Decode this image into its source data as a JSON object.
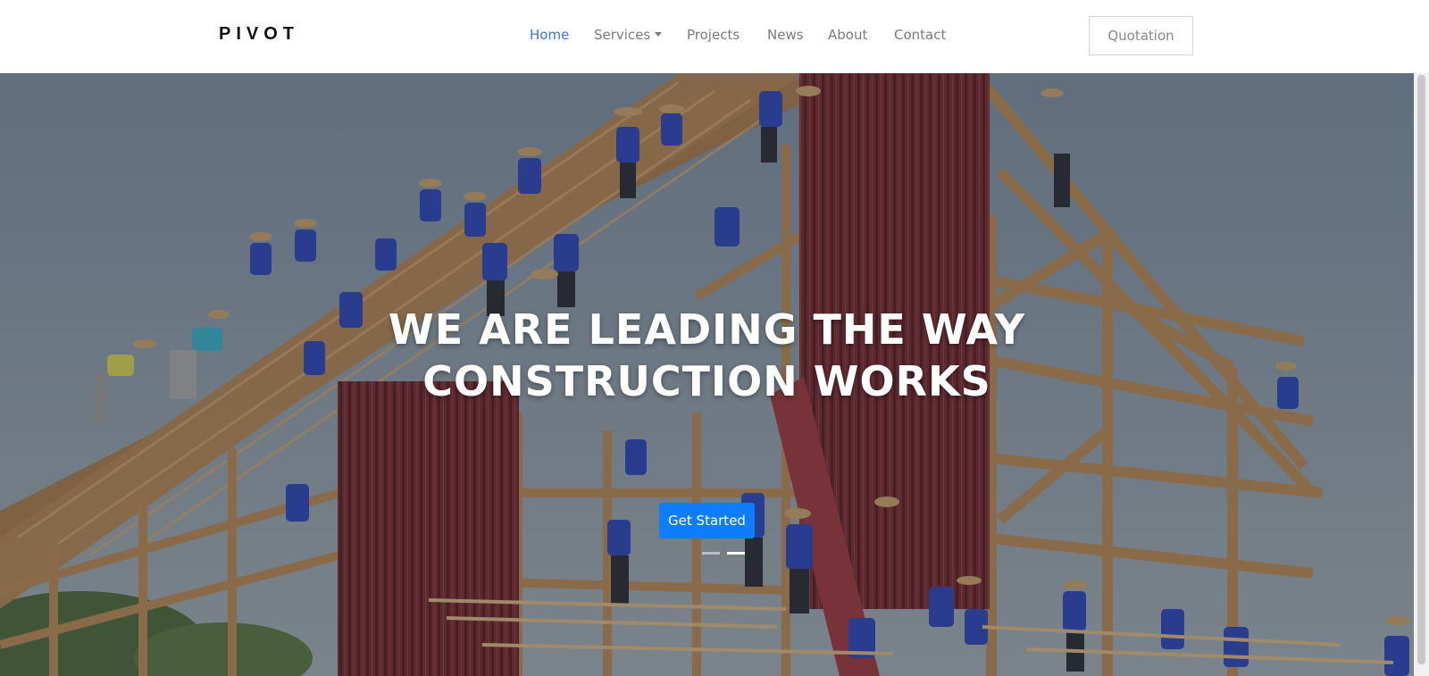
{
  "navbar": {
    "brand": "PIVOT",
    "links": [
      {
        "label": "Home",
        "active": true
      },
      {
        "label": "Services",
        "dropdown": true
      },
      {
        "label": "Projects"
      },
      {
        "label": "News"
      },
      {
        "label": "About"
      },
      {
        "label": "Contact"
      }
    ],
    "quotation_label": "Quotation"
  },
  "hero": {
    "title_line1": "WE ARE LEADING THE WAY",
    "title_line2": "CONSTRUCTION WORKS",
    "cta_label": "Get Started",
    "slides_count": 2,
    "active_slide": 2
  },
  "colors": {
    "accent": "#0d7dfc",
    "active_link": "#3a78d8",
    "nav_text": "#7c7c7c",
    "barn_red": "#7a2b30",
    "timber": "#b98a55"
  },
  "icons": {
    "dropdown": "caret-down-icon"
  }
}
